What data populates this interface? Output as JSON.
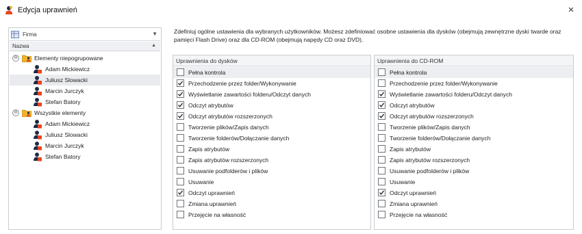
{
  "window": {
    "title": "Edycja uprawnień",
    "close_label": "×"
  },
  "left": {
    "combo_value": "Firma",
    "column_header": "Nazwa",
    "tree": [
      {
        "label": "Elementy niepogrupowane",
        "type": "group",
        "expander": "⊖"
      },
      {
        "label": "Adam Mickiewicz",
        "type": "user"
      },
      {
        "label": "Juliusz Slowacki",
        "type": "user",
        "selected": true
      },
      {
        "label": "Marcin Jurczyk",
        "type": "user"
      },
      {
        "label": "Stefan Batory",
        "type": "user"
      },
      {
        "label": "Wszystkie elementy",
        "type": "group",
        "expander": "⊖"
      },
      {
        "label": "Adam Mickiewicz",
        "type": "user"
      },
      {
        "label": "Juliusz Slowacki",
        "type": "user"
      },
      {
        "label": "Marcin Jurczyk",
        "type": "user"
      },
      {
        "label": "Stefan Batory",
        "type": "user"
      }
    ]
  },
  "description": "Zdefiniuj ogólne ustawienia dla wybranych użytkowników. Możesz zdefiniować osobne ustawienia dla dysków (obejmują zewnętrzne dyski twarde oraz pamięci Flash Drive) oraz dla CD-ROM (obejmują napędy CD oraz DVD).",
  "disk_panel": {
    "header": "Uprawnienia do dysków",
    "items": [
      {
        "label": "Pełna kontrola",
        "checked": false
      },
      {
        "label": "Przechodzenie przez folder/Wykonywanie",
        "checked": true
      },
      {
        "label": "Wyświetlanie zawartości folderu/Odczyt danych",
        "checked": true
      },
      {
        "label": "Odczyt atrybutów",
        "checked": true
      },
      {
        "label": "Odczyt atrybutów rozszerzonych",
        "checked": true
      },
      {
        "label": "Tworzenie plików/Zapis danych",
        "checked": false
      },
      {
        "label": "Tworzenie folderów/Dołączanie danych",
        "checked": false
      },
      {
        "label": "Zapis atrybutów",
        "checked": false
      },
      {
        "label": "Zapis atrybutów rozszerzonych",
        "checked": false
      },
      {
        "label": "Usuwanie podfolderów i plików",
        "checked": false
      },
      {
        "label": "Usuwanie",
        "checked": false
      },
      {
        "label": "Odczyt uprawnień",
        "checked": true
      },
      {
        "label": "Zmiana uprawnień",
        "checked": false
      },
      {
        "label": "Przejęcie na własność",
        "checked": false
      }
    ]
  },
  "cd_panel": {
    "header": "Uprawnienia do CD-ROM",
    "items": [
      {
        "label": "Pełna kontrola",
        "checked": false
      },
      {
        "label": "Przechodzenie przez folder/Wykonywanie",
        "checked": false
      },
      {
        "label": "Wyświetlanie zawartości folderu/Odczyt danych",
        "checked": true
      },
      {
        "label": "Odczyt atrybutów",
        "checked": true
      },
      {
        "label": "Odczyt atrybutów rozszerzonych",
        "checked": true
      },
      {
        "label": "Tworzenie plików/Zapis danych",
        "checked": false
      },
      {
        "label": "Tworzenie folderów/Dołączanie danych",
        "checked": false
      },
      {
        "label": "Zapis atrybutów",
        "checked": false
      },
      {
        "label": "Zapis atrybutów rozszerzonych",
        "checked": false
      },
      {
        "label": "Usuwanie podfolderów i plików",
        "checked": false
      },
      {
        "label": "Usuwanie",
        "checked": false
      },
      {
        "label": "Odczyt uprawnień",
        "checked": true
      },
      {
        "label": "Zmiana uprawnień",
        "checked": false
      },
      {
        "label": "Przejęcie na własność",
        "checked": false
      }
    ]
  },
  "colors": {
    "checkmark": "#2a2a2a",
    "user_head": "#1f2a44",
    "user_body": "#e8441f",
    "folder": "#f0b42c",
    "selected_row": "#e9ebee"
  }
}
